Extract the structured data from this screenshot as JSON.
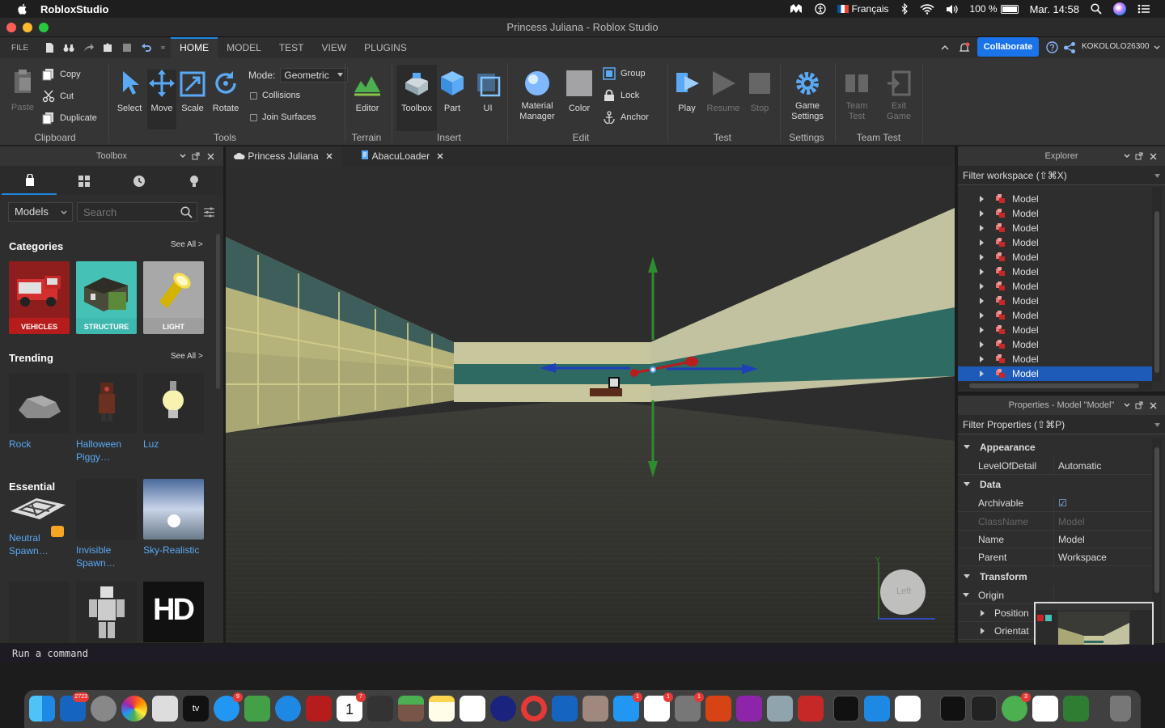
{
  "menubar": {
    "app_name": "RobloxStudio",
    "language": "Français",
    "battery": "100 %",
    "datetime": "Mar. 14:58"
  },
  "window": {
    "title": "Princess Juliana - Roblox Studio"
  },
  "ribbon_tabs": {
    "file": "FILE",
    "tabs": [
      "HOME",
      "MODEL",
      "TEST",
      "VIEW",
      "PLUGINS"
    ],
    "active": "HOME"
  },
  "header": {
    "collaborate": "Collaborate",
    "username": "KOKOLOLO26300"
  },
  "ribbon": {
    "clipboard": {
      "paste": "Paste",
      "copy": "Copy",
      "cut": "Cut",
      "duplicate": "Duplicate",
      "label": "Clipboard"
    },
    "tools": {
      "select": "Select",
      "move": "Move",
      "scale": "Scale",
      "rotate": "Rotate",
      "mode_label": "Mode:",
      "mode_value": "Geometric",
      "collisions": "Collisions",
      "join_surfaces": "Join Surfaces",
      "label": "Tools"
    },
    "terrain": {
      "editor": "Editor",
      "label": "Terrain"
    },
    "insert": {
      "toolbox": "Toolbox",
      "part": "Part",
      "ui": "UI",
      "label": "Insert"
    },
    "edit": {
      "material_manager": "Material Manager",
      "color": "Color",
      "group": "Group",
      "lock": "Lock",
      "anchor": "Anchor",
      "label": "Edit"
    },
    "test": {
      "play": "Play",
      "resume": "Resume",
      "stop": "Stop",
      "label": "Test"
    },
    "settings": {
      "game_settings": "Game Settings",
      "label": "Settings"
    },
    "team_test": {
      "team_test": "Team Test",
      "exit_game": "Exit Game",
      "label": "Team Test"
    }
  },
  "toolbox": {
    "title": "Toolbox",
    "dropdown": "Models",
    "search_placeholder": "Search",
    "categories_title": "Categories",
    "see_all": "See All >",
    "categories": [
      "VEHICLES",
      "STRUCTURE",
      "LIGHT"
    ],
    "trending_title": "Trending",
    "trending": [
      {
        "name": "Rock"
      },
      {
        "name": "Halloween Piggy…"
      },
      {
        "name": "Luz"
      }
    ],
    "essential_title": "Essential",
    "essential": [
      {
        "name": "Neutral Spawn…"
      },
      {
        "name": "Invisible Spawn…"
      },
      {
        "name": "Sky-Realistic"
      }
    ],
    "hd_label": "HD"
  },
  "doc_tabs": [
    {
      "label": "Princess Juliana"
    },
    {
      "label": "AbacuLoader"
    }
  ],
  "viewport": {
    "view_cube_label": "Left",
    "axis_y": "Y"
  },
  "explorer": {
    "title": "Explorer",
    "filter": "Filter workspace (⇧⌘X)",
    "items": [
      "Model",
      "Model",
      "Model",
      "Model",
      "Model",
      "Model",
      "Model",
      "Model",
      "Model",
      "Model",
      "Model",
      "Model",
      "Model"
    ],
    "selected_index": 12
  },
  "properties": {
    "title": "Properties - Model \"Model\"",
    "filter": "Filter Properties (⇧⌘P)",
    "sections": {
      "appearance": "Appearance",
      "data": "Data",
      "transform": "Transform"
    },
    "rows": {
      "level_of_detail": {
        "key": "LevelOfDetail",
        "value": "Automatic"
      },
      "archivable": {
        "key": "Archivable",
        "value": "☑"
      },
      "class_name": {
        "key": "ClassName",
        "value": "Model"
      },
      "name": {
        "key": "Name",
        "value": "Model"
      },
      "parent": {
        "key": "Parent",
        "value": "Workspace"
      },
      "origin": {
        "key": "Origin"
      },
      "position": {
        "key": "Position"
      },
      "orientation": {
        "key": "Orientat"
      }
    }
  },
  "command_bar": {
    "placeholder": "Run a command"
  },
  "dock": {
    "badges": {
      "photos": "2723",
      "messages": "9",
      "calendar": "7",
      "appstore": "1",
      "music": "1",
      "prefs": "1",
      "amphetamine": "3"
    },
    "calendar_day": "1"
  },
  "colors": {
    "accent": "#1e88e5",
    "selection": "#1e5bb8",
    "link": "#5aa9f5"
  }
}
